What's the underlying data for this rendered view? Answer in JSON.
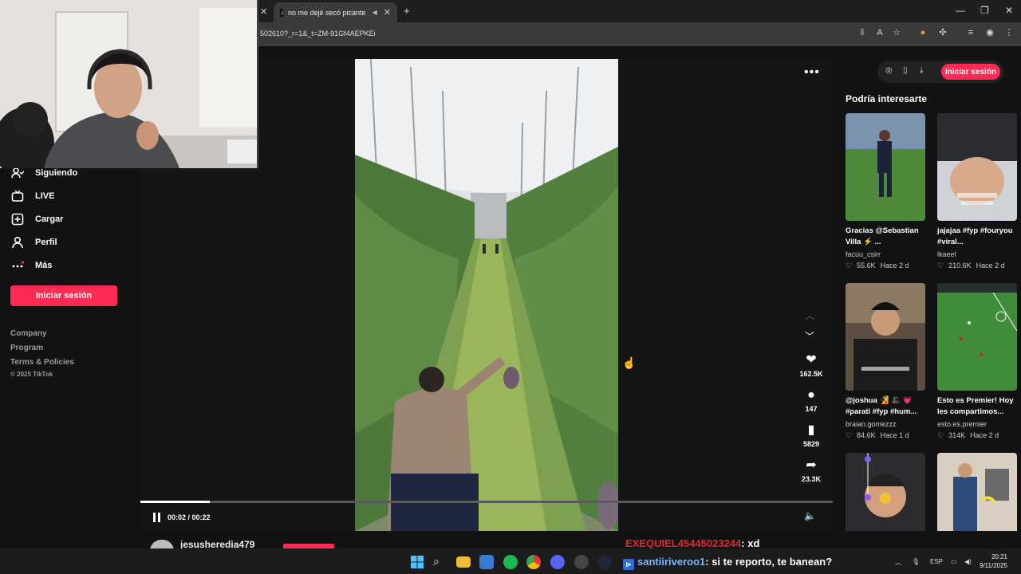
{
  "browser": {
    "tab_title": "no me dejé secó picante",
    "url": "502610?_r=1&_t=ZM-91Gf4AEPKEi",
    "new_tab_icon": "plus-icon"
  },
  "sidebar": {
    "items": [
      {
        "label": "Siguiendo",
        "icon": "following-icon"
      },
      {
        "label": "LIVE",
        "icon": "live-icon"
      },
      {
        "label": "Cargar",
        "icon": "upload-icon"
      },
      {
        "label": "Perfil",
        "icon": "profile-icon"
      },
      {
        "label": "Más",
        "icon": "more-icon"
      }
    ],
    "login_label": "Iniciar sesión",
    "footer_links": [
      "Company",
      "Program",
      "Terms & Policies"
    ],
    "copyright": "© 2025 TikTok"
  },
  "video": {
    "progress": 0.1,
    "time": "00:02 / 00:22",
    "actions": [
      {
        "icon": "heart-icon",
        "count": "162.5K"
      },
      {
        "icon": "comment-icon",
        "count": "147"
      },
      {
        "icon": "bookmark-icon",
        "count": "5829"
      },
      {
        "icon": "share-icon",
        "count": "23.3K"
      }
    ],
    "author": "jesusheredia479"
  },
  "right": {
    "login_label": "Iniciar sesión",
    "section_title": "Podría interesarte",
    "cards": [
      {
        "caption": "Gracias @Sebastian Villa ⚡ ...",
        "author": "facuu_csirr",
        "likes": "55.6K",
        "age": "Hace 2 d"
      },
      {
        "caption": "jajajaa #fyp #fouryou #viral...",
        "author": "lkaeel",
        "likes": "210.6K",
        "age": "Hace 2 d"
      },
      {
        "caption": "@joshua 🧏 🎩 💗 #parati #fyp #hum...",
        "author": "braian.gomezzz",
        "likes": "84.6K",
        "age": "Hace 1 d"
      },
      {
        "caption": "Esto es Premier! Hoy les compartimos...",
        "author": "esto.es.premier",
        "likes": "314K",
        "age": "Hace 2 d"
      }
    ]
  },
  "overlay": {
    "chat": [
      {
        "user": "EXEQUIEL45445023244",
        "msg": ": xd"
      },
      {
        "user": "santiiriveroo1",
        "msg": ": si te reporto, te banean?"
      }
    ]
  },
  "taskbar": {
    "lang": "ESP",
    "time": "20:21",
    "date": "9/11/2025"
  },
  "colors": {
    "accent": "#fe2c55",
    "page_bg": "#121212",
    "chat_user_red": "#e32636",
    "chat_user_blue": "#7db7ff"
  }
}
